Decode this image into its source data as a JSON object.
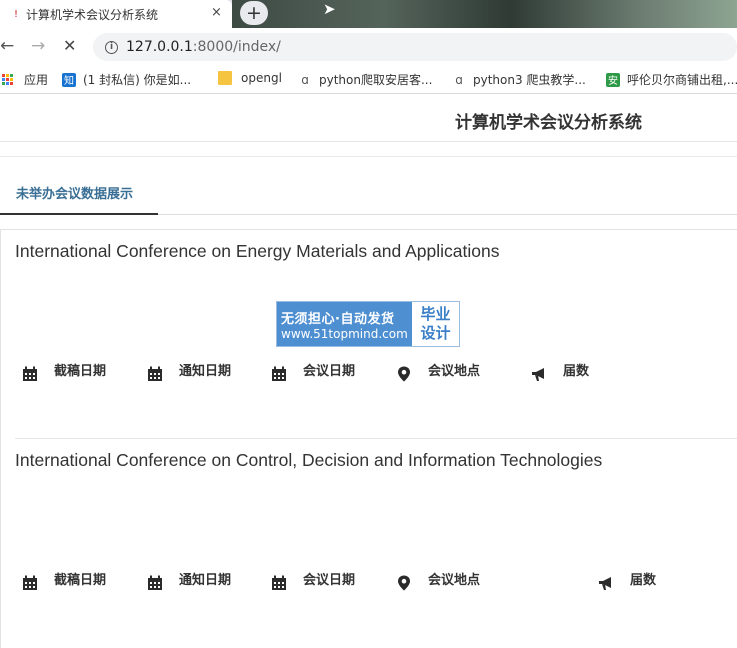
{
  "browser": {
    "tab_title": "计算机学术会议分析系统",
    "tab_close": "×",
    "new_tab": "+",
    "back": "←",
    "forward": "→",
    "reload": "✕",
    "url_host": "127.0.0.1",
    "url_rest": ":8000/index/",
    "bookmarks": [
      {
        "label": "应用"
      },
      {
        "label": "(1 封私信) 你是如...",
        "icon_text": "知"
      },
      {
        "label": "opengl"
      },
      {
        "label": "python爬取安居客..."
      },
      {
        "label": "python3 爬虫教学..."
      },
      {
        "label": "呼伦贝尔商铺出租,...",
        "icon_text": "安"
      }
    ]
  },
  "site": {
    "title": "计算机学术会议分析系统",
    "active_tab": "未举办会议数据展示"
  },
  "watermark": {
    "line1": "无须担心·自动发货",
    "line2": "www.51topmind.com",
    "right1": "毕业",
    "right2": "设计"
  },
  "conferences": [
    {
      "title": "International Conference on Energy Materials and Applications",
      "fields": {
        "deadline": "截稿日期",
        "notification": "通知日期",
        "conference_date": "会议日期",
        "location": "会议地点",
        "session": "届数"
      }
    },
    {
      "title": "International Conference on Control, Decision and Information Technologies",
      "fields": {
        "deadline": "截稿日期",
        "notification": "通知日期",
        "conference_date": "会议日期",
        "location": "会议地点",
        "session": "届数"
      }
    }
  ],
  "colors": {
    "accent_tab_text": "#3a6f95",
    "watermark_blue": "#4d8fd1"
  }
}
